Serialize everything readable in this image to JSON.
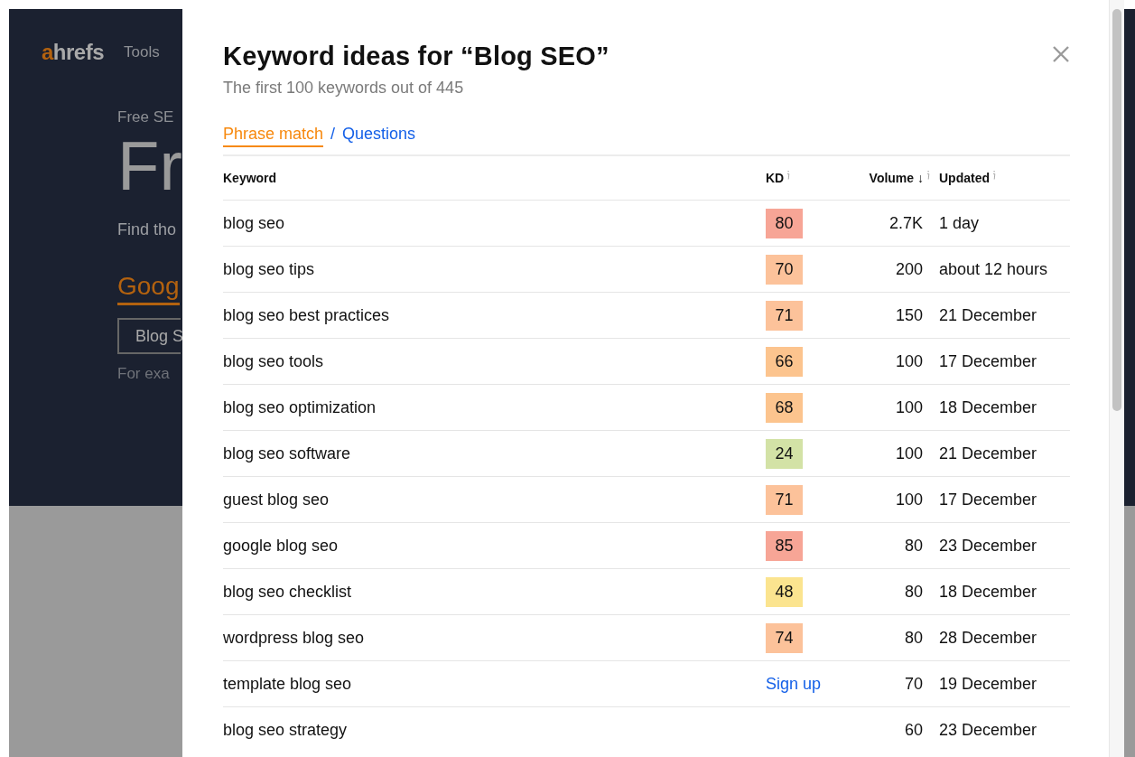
{
  "background": {
    "logo_accent": "a",
    "logo_rest": "hrefs",
    "nav_item": "Tools",
    "eyebrow": "Free SE",
    "headline": "Fr",
    "lead": "Find tho",
    "tab": "Goog",
    "search_value": "Blog S",
    "hint": "For exa"
  },
  "modal": {
    "title": "Keyword ideas for “Blog SEO”",
    "subtitle": "The first 100 keywords out of 445",
    "tabs": [
      {
        "label": "Phrase match",
        "selected": true
      },
      {
        "label": "Questions",
        "selected": false
      }
    ],
    "separator": "/",
    "table": {
      "columns": [
        {
          "label": "Keyword"
        },
        {
          "label": "KD",
          "info": true
        },
        {
          "label": "Volume",
          "info": true,
          "sort": "↓"
        },
        {
          "label": "Updated",
          "info": true
        }
      ],
      "rows": [
        {
          "keyword": "blog seo",
          "kd": {
            "kind": "badge",
            "text": "80",
            "color": "#f7a596"
          },
          "volume": "2.7K",
          "updated": "1 day"
        },
        {
          "keyword": "blog seo tips",
          "kd": {
            "kind": "badge",
            "text": "70",
            "color": "#fcc29a"
          },
          "volume": "200",
          "updated": "about 12 hours"
        },
        {
          "keyword": "blog seo best practices",
          "kd": {
            "kind": "badge",
            "text": "71",
            "color": "#fcc29a"
          },
          "volume": "150",
          "updated": "21 December"
        },
        {
          "keyword": "blog seo tools",
          "kd": {
            "kind": "badge",
            "text": "66",
            "color": "#fcc48e"
          },
          "volume": "100",
          "updated": "17 December"
        },
        {
          "keyword": "blog seo optimization",
          "kd": {
            "kind": "badge",
            "text": "68",
            "color": "#fcc48e"
          },
          "volume": "100",
          "updated": "18 December"
        },
        {
          "keyword": "blog seo software",
          "kd": {
            "kind": "badge",
            "text": "24",
            "color": "#d3e2a6"
          },
          "volume": "100",
          "updated": "21 December"
        },
        {
          "keyword": "guest blog seo",
          "kd": {
            "kind": "badge",
            "text": "71",
            "color": "#fcc29a"
          },
          "volume": "100",
          "updated": "17 December"
        },
        {
          "keyword": "google blog seo",
          "kd": {
            "kind": "badge",
            "text": "85",
            "color": "#f7a596"
          },
          "volume": "80",
          "updated": "23 December"
        },
        {
          "keyword": "blog seo checklist",
          "kd": {
            "kind": "badge",
            "text": "48",
            "color": "#fbe48f"
          },
          "volume": "80",
          "updated": "18 December"
        },
        {
          "keyword": "wordpress blog seo",
          "kd": {
            "kind": "badge",
            "text": "74",
            "color": "#fcc29a"
          },
          "volume": "80",
          "updated": "28 December"
        },
        {
          "keyword": "template blog seo",
          "kd": {
            "kind": "link",
            "text": "Sign up"
          },
          "volume": "70",
          "updated": "19 December"
        },
        {
          "keyword": "blog seo strategy",
          "kd": {
            "kind": "none"
          },
          "volume": "60",
          "updated": "23 December"
        }
      ]
    }
  }
}
